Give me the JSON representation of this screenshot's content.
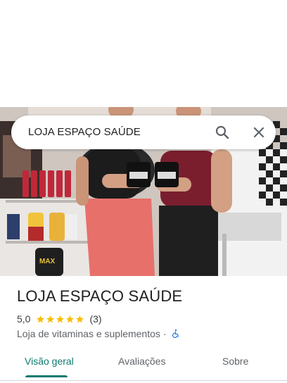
{
  "search": {
    "query": "LOJA ESPAÇO SAÚDE",
    "search_icon": "search-icon",
    "close_icon": "close-icon"
  },
  "photo": {
    "label": "MAX"
  },
  "place": {
    "name": "LOJA ESPAÇO SAÚDE",
    "rating": "5,0",
    "stars": 5,
    "reviews": "(3)",
    "category": "Loja de vitaminas e suplementos",
    "separator": "·",
    "accessibility_icon": "wheelchair-icon"
  },
  "tabs": [
    {
      "label": "Visão geral",
      "active": true
    },
    {
      "label": "Avaliações",
      "active": false
    },
    {
      "label": "Sobre",
      "active": false
    }
  ],
  "colors": {
    "accent": "#0b7a6e",
    "star": "#fbbc04",
    "accessibility": "#1a73e8"
  }
}
